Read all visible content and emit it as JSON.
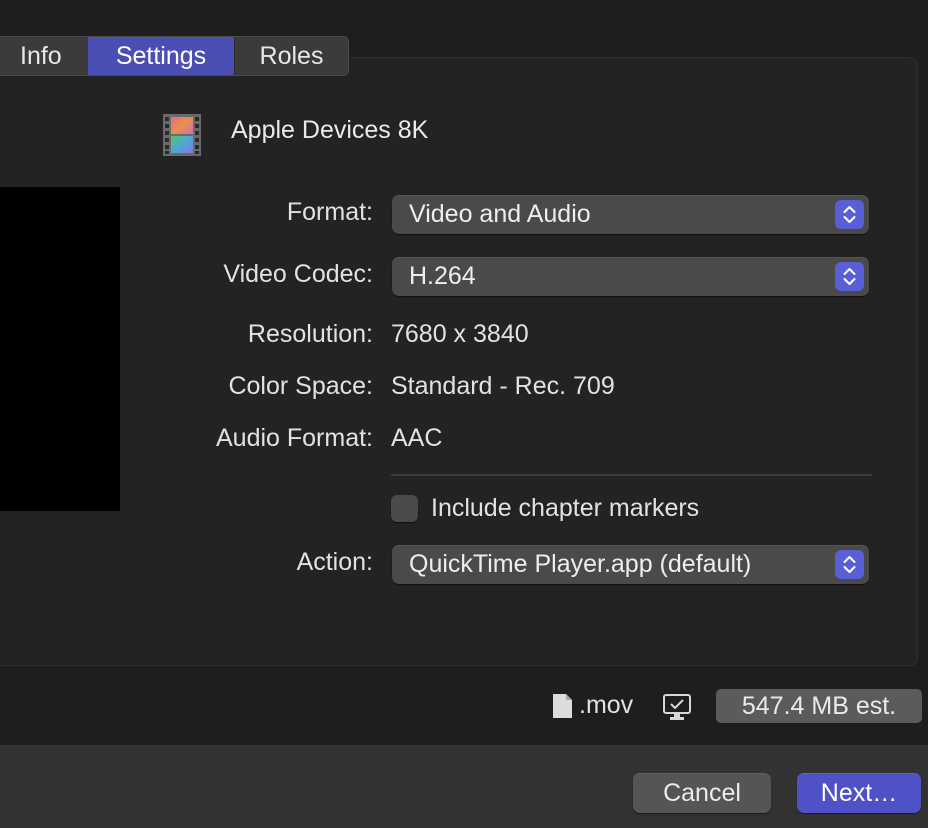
{
  "tabs": [
    {
      "label": "Info",
      "selected": false
    },
    {
      "label": "Settings",
      "selected": true
    },
    {
      "label": "Roles",
      "selected": false
    }
  ],
  "preset": {
    "name": "Apple Devices 8K",
    "icon": "film-strip-icon"
  },
  "fields": {
    "format": {
      "label": "Format:",
      "value": "Video and Audio"
    },
    "video_codec": {
      "label": "Video Codec:",
      "value": "H.264"
    },
    "resolution": {
      "label": "Resolution:",
      "value": "7680 x 3840"
    },
    "color_space": {
      "label": "Color Space:",
      "value": "Standard - Rec. 709"
    },
    "audio_format": {
      "label": "Audio Format:",
      "value": "AAC"
    },
    "action": {
      "label": "Action:",
      "value": "QuickTime Player.app (default)"
    }
  },
  "chapter_markers": {
    "label": "Include chapter markers",
    "checked": false
  },
  "footer": {
    "extension": ".mov",
    "size_estimate": "547.4 MB est."
  },
  "buttons": {
    "cancel": "Cancel",
    "next": "Next…"
  },
  "colors": {
    "accent": "#4b4fb3",
    "stepper": "#5a5fd6",
    "background": "#1e1e1e",
    "panel": "#232323"
  }
}
